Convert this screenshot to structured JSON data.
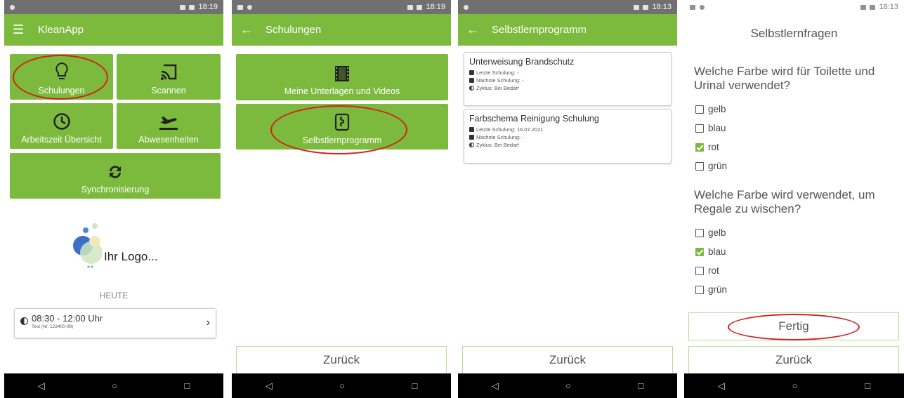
{
  "colors": {
    "accent": "#7cba3d",
    "annotation": "#d42020"
  },
  "screens": [
    {
      "status": {
        "time": "18:19"
      },
      "appbar": {
        "title": "KleanApp",
        "lead_icon": "menu-icon"
      },
      "tiles": [
        {
          "label": "Schulungen",
          "icon": "lightbulb-icon"
        },
        {
          "label": "Scannen",
          "icon": "cast-icon"
        },
        {
          "label": "Arbeitszeit Übersicht",
          "icon": "clock-icon"
        },
        {
          "label": "Abwesenheiten",
          "icon": "airplane-icon"
        },
        {
          "label": "Synchronisierung",
          "icon": "sync-icon"
        }
      ],
      "logo_text": "Ihr Logo...",
      "today_label": "HEUTE",
      "shift": {
        "time": "08:30 - 12:00 Uhr",
        "detail": "Test (Nr. 123400-08)"
      }
    },
    {
      "status": {
        "time": "18:19"
      },
      "appbar": {
        "title": "Schulungen",
        "lead_icon": "back-arrow-icon"
      },
      "tiles": [
        {
          "label": "Meine Unterlagen und Videos",
          "icon": "film-icon"
        },
        {
          "label": "Selbstlernprogramm",
          "icon": "learning-icon"
        }
      ],
      "back_button": "Zurück"
    },
    {
      "status": {
        "time": "18:13"
      },
      "appbar": {
        "title": "Selbstlernprogramm",
        "lead_icon": "back-arrow-icon"
      },
      "cards": [
        {
          "title": "Unterweisung Brandschutz",
          "last": "Letzte Schulung: -",
          "next": "Nächste Schulung: -",
          "cycle": "Zyklus: Bei Bedarf"
        },
        {
          "title": "Farbschema Reinigung Schulung",
          "last": "Letzte Schulung: 16.07.2021",
          "next": "Nächste Schulung: -",
          "cycle": "Zyklus: Bei Bedarf"
        }
      ],
      "back_button": "Zurück"
    },
    {
      "status": {
        "time": "18:13"
      },
      "title": "Selbstlernfragen",
      "questions": [
        {
          "text": "Welche Farbe wird für Toilette und Urinal verwendet?",
          "options": [
            {
              "label": "gelb",
              "checked": false
            },
            {
              "label": "blau",
              "checked": false
            },
            {
              "label": "rot",
              "checked": true
            },
            {
              "label": "grün",
              "checked": false
            }
          ]
        },
        {
          "text": "Welche Farbe wird verwendet, um Regale zu wischen?",
          "options": [
            {
              "label": "gelb",
              "checked": false
            },
            {
              "label": "blau",
              "checked": true
            },
            {
              "label": "rot",
              "checked": false
            },
            {
              "label": "grün",
              "checked": false
            }
          ]
        }
      ],
      "done_button": "Fertig",
      "back_button": "Zurück"
    }
  ],
  "nav_icons": [
    "back-triangle-icon",
    "home-circle-icon",
    "recents-square-icon"
  ]
}
